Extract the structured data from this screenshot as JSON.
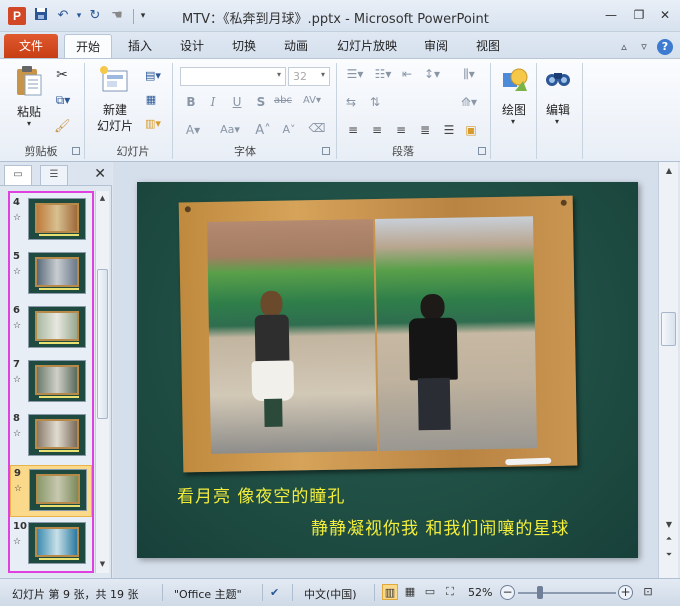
{
  "titlebar": {
    "app_icon": "P",
    "title": "MTV：《私奔到月球》.pptx - Microsoft PowerPoint",
    "quick_access": [
      "save-icon",
      "undo-icon",
      "redo-icon",
      "touch-icon",
      "customize-icon"
    ]
  },
  "tabs": {
    "file": "文件",
    "items": [
      "开始",
      "插入",
      "设计",
      "切换",
      "动画",
      "幻灯片放映",
      "审阅",
      "视图"
    ],
    "active": "开始"
  },
  "ribbon": {
    "clipboard": {
      "paste": "粘贴",
      "label": "剪贴板"
    },
    "slides": {
      "new_slide_1": "新建",
      "new_slide_2": "幻灯片",
      "label": "幻灯片"
    },
    "font": {
      "font_name": "",
      "font_size": "32",
      "label": "字体"
    },
    "paragraph": {
      "label": "段落"
    },
    "drawing": {
      "label": "绘图"
    },
    "editing": {
      "label": "编辑"
    }
  },
  "left_pane": {
    "thumbnails": [
      {
        "num": "4",
        "star": "☆"
      },
      {
        "num": "5",
        "star": "☆"
      },
      {
        "num": "6",
        "star": "☆"
      },
      {
        "num": "7",
        "star": "☆"
      },
      {
        "num": "8",
        "star": "☆"
      },
      {
        "num": "9",
        "star": "☆"
      },
      {
        "num": "10",
        "star": "☆"
      }
    ],
    "selected": "9"
  },
  "slide": {
    "lyric_line1": "看月亮 像夜空的瞳孔",
    "lyric_line2": "静静凝视你我 和我们闹嚷的星球",
    "lyric_color": "#f3ee3a",
    "background_color": "#1f4e44"
  },
  "statusbar": {
    "slide_info": "幻灯片 第 9 张，共 19 张",
    "theme": "\"Office 主题\"",
    "language": "中文(中国)",
    "zoom": "52%"
  }
}
